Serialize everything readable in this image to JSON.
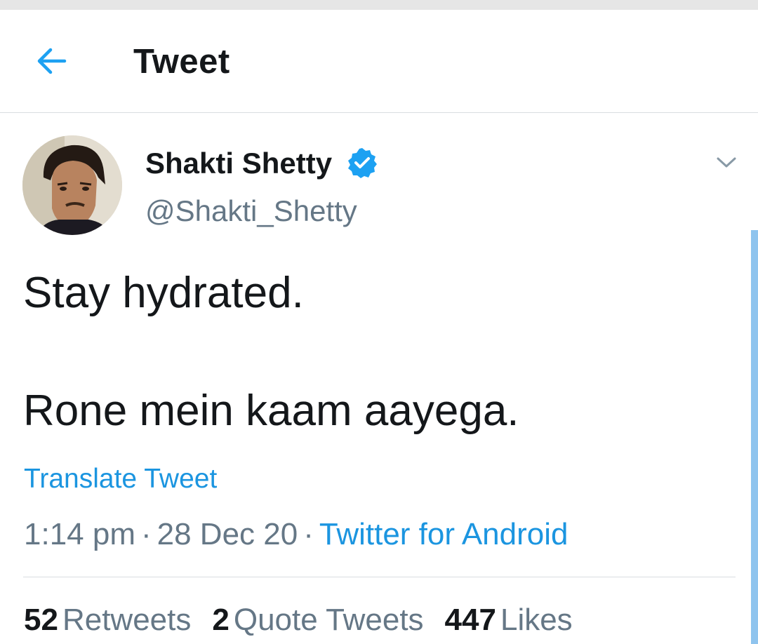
{
  "header": {
    "title": "Tweet",
    "back_icon": "arrow-left-icon",
    "accent_color": "#1da1f2"
  },
  "author": {
    "display_name": "Shakti Shetty",
    "handle": "@Shakti_Shetty",
    "verified_icon": "verified-badge-icon",
    "menu_icon": "chevron-down-icon"
  },
  "tweet": {
    "line1": "Stay hydrated.",
    "line2": "Rone mein kaam aayega.",
    "translate_label": "Translate Tweet"
  },
  "meta": {
    "time": "1:14 pm",
    "separator": "·",
    "date": "28 Dec 20",
    "source": "Twitter for Android",
    "link_color": "#1b95e0"
  },
  "stats": {
    "retweets_count": "52",
    "retweets_label": "Retweets",
    "quotes_count": "2",
    "quotes_label": "Quote Tweets",
    "likes_count": "447",
    "likes_label": "Likes"
  }
}
